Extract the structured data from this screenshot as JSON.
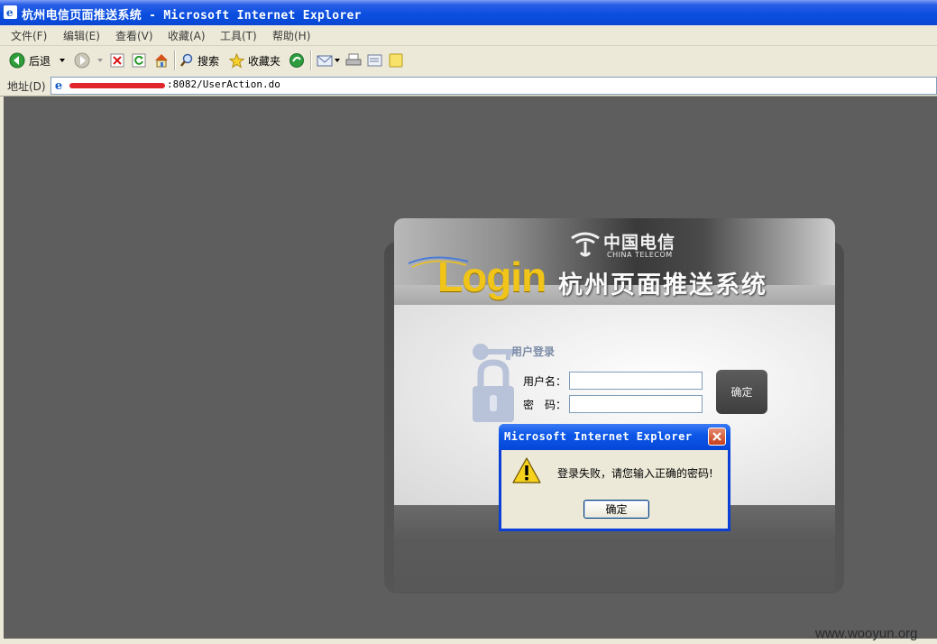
{
  "window": {
    "title": "杭州电信页面推送系统 - Microsoft Internet Explorer"
  },
  "menu": {
    "items": [
      {
        "label": "文件(F)"
      },
      {
        "label": "编辑(E)"
      },
      {
        "label": "查看(V)"
      },
      {
        "label": "收藏(A)"
      },
      {
        "label": "工具(T)"
      },
      {
        "label": "帮助(H)"
      }
    ]
  },
  "toolbar": {
    "back_label": "后退",
    "search_label": "搜索",
    "favorites_label": "收藏夹"
  },
  "address": {
    "label": "地址(D)",
    "url_visible": ":8082/UserAction.do"
  },
  "login": {
    "brand_cn": "中国电信",
    "brand_en": "CHINA TELECOM",
    "login_word": "Login",
    "system_name": "杭州页面推送系统",
    "section_title": "用户登录",
    "username_label": "用户名：",
    "password_label": "密　码：",
    "username_value": "",
    "password_value": "",
    "submit_label": "确定"
  },
  "dialog": {
    "title": "Microsoft Internet Explorer",
    "message": "登录失败，请您输入正确的密码!",
    "ok_label": "确定"
  },
  "watermark": "www.wooyun.org",
  "colors": {
    "titlebar": "#0b4fe0",
    "chrome": "#ece9d8",
    "background": "#5e5e5e",
    "login_accent": "#f0c418"
  }
}
